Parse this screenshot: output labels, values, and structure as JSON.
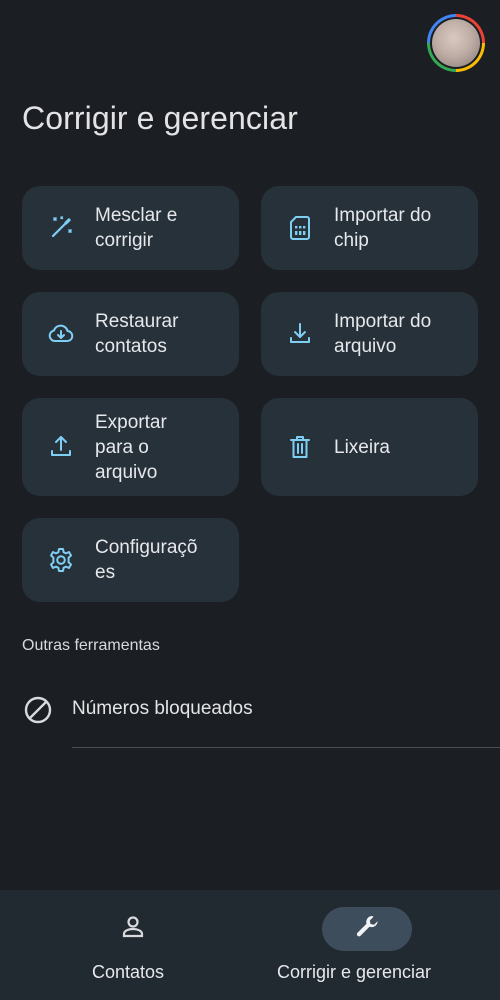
{
  "header": {
    "avatar_label": "",
    "title": "Corrigir e gerenciar"
  },
  "actions": [
    {
      "label": "Mesclar e\ncorrigir",
      "icon": "magic-wand-icon"
    },
    {
      "label": "Importar do\nchip",
      "icon": "sim-card-icon"
    },
    {
      "label": "Restaurar\ncontatos",
      "icon": "cloud-download-icon"
    },
    {
      "label": "Importar do\narquivo",
      "icon": "download-icon"
    },
    {
      "label": "Exportar\npara o\narquivo",
      "icon": "upload-icon"
    },
    {
      "label": "Lixeira",
      "icon": "trash-icon"
    },
    {
      "label": "Configuraçõ\nes",
      "icon": "gear-icon"
    }
  ],
  "other_tools": {
    "title": "Outras ferramentas",
    "items": [
      {
        "label": "Números bloqueados",
        "icon": "block-icon"
      }
    ]
  },
  "bottom_nav": {
    "items": [
      {
        "label": "Contatos",
        "icon": "person-icon",
        "active": false
      },
      {
        "label": "Corrigir e gerenciar",
        "icon": "wrench-icon",
        "active": true
      }
    ]
  },
  "colors": {
    "background": "#1b1e22",
    "card": "#27313a",
    "accent_icon": "#7fcff5",
    "active_pill": "#3e4d5c"
  }
}
